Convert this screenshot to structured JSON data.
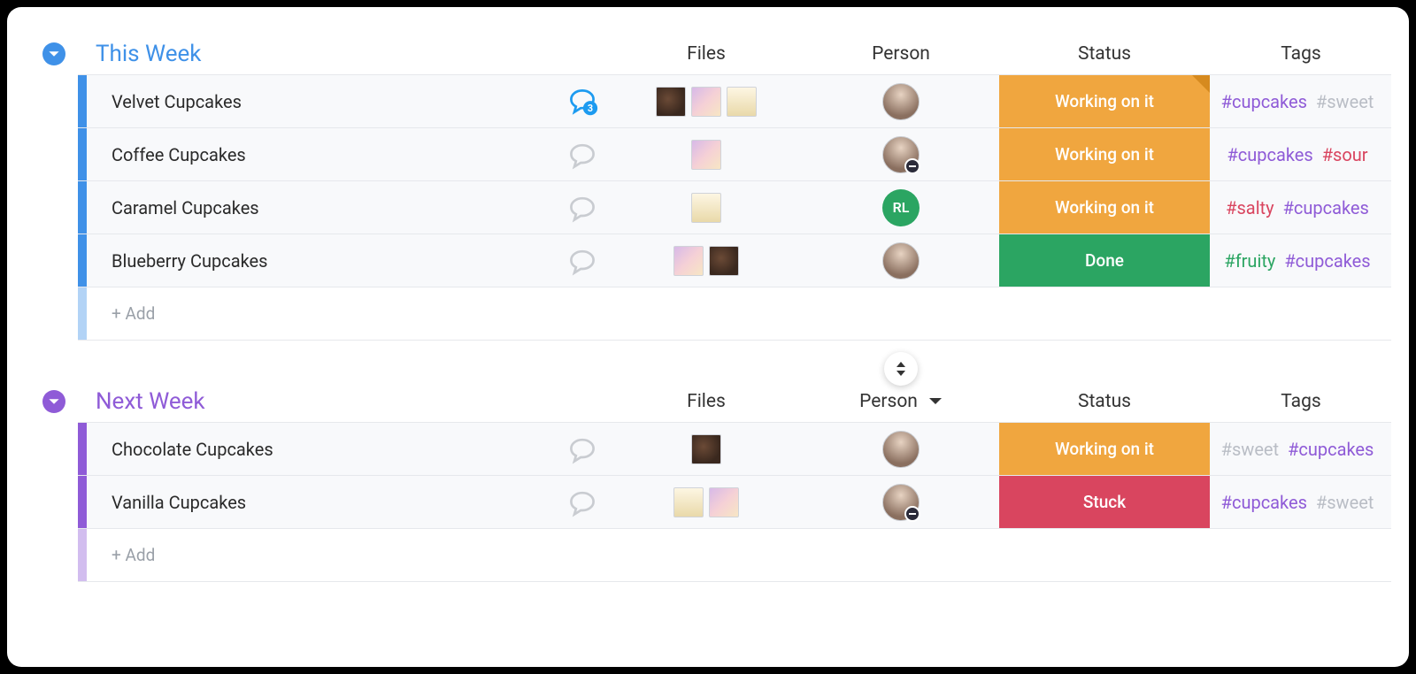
{
  "columns": {
    "files": "Files",
    "person": "Person",
    "status": "Status",
    "tags": "Tags"
  },
  "add_label": "+ Add",
  "tag_colors": {
    "purple": "#8f5bd7",
    "grey": "#b9bdc5",
    "red": "#d9455f",
    "green": "#2ba562"
  },
  "status_colors": {
    "working": "#f0a63f",
    "done": "#2ba562",
    "stuck": "#d9455f"
  },
  "groups": [
    {
      "id": "this_week",
      "title": "This Week",
      "color": "#3f91e8",
      "person_sort_visible": false,
      "rows": [
        {
          "name": "Velvet Cupcakes",
          "chat_count": 3,
          "files": [
            "dark",
            "pink",
            "cream"
          ],
          "person": {
            "type": "photo",
            "dnd": false
          },
          "status": {
            "label": "Working on it",
            "color_key": "working",
            "fold": true
          },
          "tags": [
            {
              "text": "#cupcakes",
              "color_key": "purple"
            },
            {
              "text": "#sweet",
              "color_key": "grey"
            }
          ]
        },
        {
          "name": "Coffee Cupcakes",
          "chat_count": 0,
          "files": [
            "pink"
          ],
          "person": {
            "type": "photo",
            "dnd": true
          },
          "status": {
            "label": "Working on it",
            "color_key": "working",
            "fold": false
          },
          "tags": [
            {
              "text": "#cupcakes",
              "color_key": "purple"
            },
            {
              "text": "#sour",
              "color_key": "red"
            }
          ]
        },
        {
          "name": "Caramel Cupcakes",
          "chat_count": 0,
          "files": [
            "cream"
          ],
          "person": {
            "type": "initials",
            "initials": "RL",
            "dnd": false
          },
          "status": {
            "label": "Working on it",
            "color_key": "working",
            "fold": false
          },
          "tags": [
            {
              "text": "#salty",
              "color_key": "red"
            },
            {
              "text": "#cupcakes",
              "color_key": "purple"
            }
          ]
        },
        {
          "name": "Blueberry Cupcakes",
          "chat_count": 0,
          "files": [
            "pink",
            "dark"
          ],
          "person": {
            "type": "photo",
            "dnd": false
          },
          "status": {
            "label": "Done",
            "color_key": "done",
            "fold": false
          },
          "tags": [
            {
              "text": "#fruity",
              "color_key": "green"
            },
            {
              "text": "#cupcakes",
              "color_key": "purple"
            }
          ]
        }
      ]
    },
    {
      "id": "next_week",
      "title": "Next Week",
      "color": "#8f5bd7",
      "person_sort_visible": true,
      "rows": [
        {
          "name": "Chocolate Cupcakes",
          "chat_count": 0,
          "files": [
            "dark"
          ],
          "person": {
            "type": "photo",
            "dnd": false
          },
          "status": {
            "label": "Working on it",
            "color_key": "working",
            "fold": false
          },
          "tags": [
            {
              "text": "#sweet",
              "color_key": "grey"
            },
            {
              "text": "#cupcakes",
              "color_key": "purple"
            }
          ]
        },
        {
          "name": "Vanilla Cupcakes",
          "chat_count": 0,
          "files": [
            "cream",
            "pink"
          ],
          "person": {
            "type": "photo",
            "dnd": true
          },
          "status": {
            "label": "Stuck",
            "color_key": "stuck",
            "fold": false
          },
          "tags": [
            {
              "text": "#cupcakes",
              "color_key": "purple"
            },
            {
              "text": "#sweet",
              "color_key": "grey"
            }
          ]
        }
      ]
    }
  ]
}
